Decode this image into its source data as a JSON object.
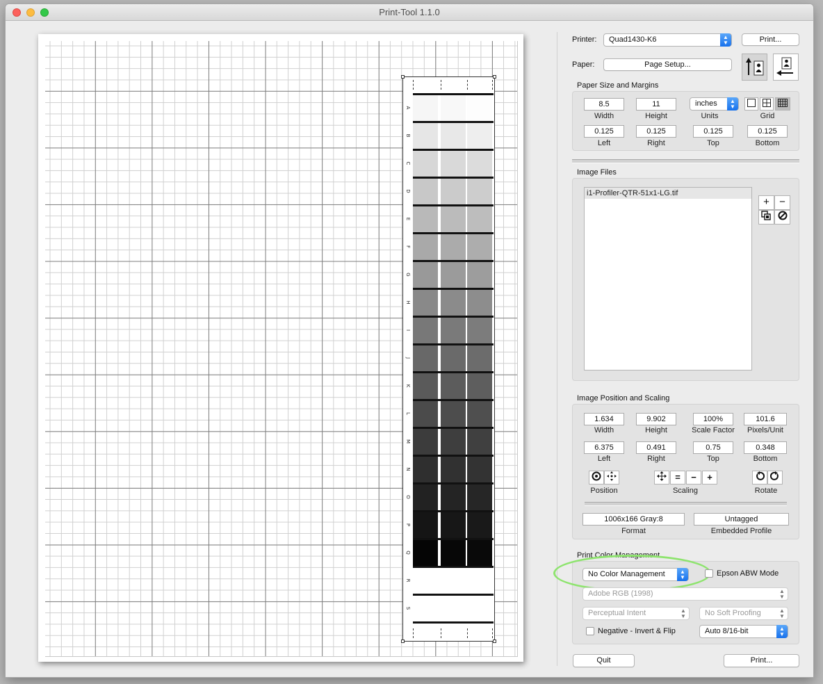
{
  "window": {
    "title": "Print-Tool 1.1.0"
  },
  "page_target": {
    "row_labels": [
      "A",
      "B",
      "C",
      "D",
      "E",
      "F",
      "G",
      "H",
      "I",
      "J",
      "K",
      "L",
      "M",
      "N",
      "O",
      "P",
      "Q",
      "R",
      "S"
    ],
    "row_grays": [
      [
        "#f6f6f6",
        "#f8f8f8",
        "#fdfdfd"
      ],
      [
        "#e6e6e6",
        "#e8e8e8",
        "#eeeeee"
      ],
      [
        "#d7d7d7",
        "#d9d9d9",
        "#dcdcdc"
      ],
      [
        "#c8c8c8",
        "#cbcbcb",
        "#cdcdcd"
      ],
      [
        "#b9b9b9",
        "#bbbbbb",
        "#bdbdbd"
      ],
      [
        "#a9a9a9",
        "#ababab",
        "#adadad"
      ],
      [
        "#999999",
        "#9b9b9b",
        "#9d9d9d"
      ],
      [
        "#898989",
        "#8b8b8b",
        "#8d8d8d"
      ],
      [
        "#787878",
        "#7a7a7a",
        "#7c7c7c"
      ],
      [
        "#686868",
        "#6a6a6a",
        "#6c6c6c"
      ],
      [
        "#5a5a5a",
        "#5c5c5c",
        "#5e5e5e"
      ],
      [
        "#4b4b4b",
        "#4d4d4d",
        "#4f4f4f"
      ],
      [
        "#3c3c3c",
        "#3e3e3e",
        "#404040"
      ],
      [
        "#2f2f2f",
        "#313131",
        "#333333"
      ],
      [
        "#222222",
        "#242424",
        "#262626"
      ],
      [
        "#151515",
        "#171717",
        "#191919"
      ],
      [
        "#050505",
        "#070707",
        "#090909"
      ]
    ]
  },
  "printer": {
    "label": "Printer:",
    "value": "Quad1430-K6",
    "print_button": "Print..."
  },
  "paper": {
    "label": "Paper:",
    "page_setup_button": "Page Setup..."
  },
  "orientation": {
    "portrait_icon": "portrait-icon",
    "landscape_icon": "landscape-icon"
  },
  "paper_size": {
    "title": "Paper Size and Margins",
    "width": {
      "value": "8.5",
      "label": "Width"
    },
    "height": {
      "value": "11",
      "label": "Height"
    },
    "units": {
      "value": "inches",
      "label": "Units"
    },
    "grid": {
      "label": "Grid"
    },
    "left": {
      "value": "0.125",
      "label": "Left"
    },
    "right": {
      "value": "0.125",
      "label": "Right"
    },
    "top": {
      "value": "0.125",
      "label": "Top"
    },
    "bottom": {
      "value": "0.125",
      "label": "Bottom"
    }
  },
  "image_files": {
    "title": "Image Files",
    "files": [
      "i1-Profiler-QTR-51x1-LG.tif"
    ],
    "add": "+",
    "remove": "−"
  },
  "image_position": {
    "title": "Image Position and Scaling",
    "width": {
      "value": "1.634",
      "label": "Width"
    },
    "height": {
      "value": "9.902",
      "label": "Height"
    },
    "scale": {
      "value": "100%",
      "label": "Scale Factor"
    },
    "ppu": {
      "value": "101.6",
      "label": "Pixels/Unit"
    },
    "left": {
      "value": "6.375",
      "label": "Left"
    },
    "right": {
      "value": "0.491",
      "label": "Right"
    },
    "top": {
      "value": "0.75",
      "label": "Top"
    },
    "bottom": {
      "value": "0.348",
      "label": "Bottom"
    },
    "position_label": "Position",
    "scaling_label": "Scaling",
    "rotate_label": "Rotate",
    "format": {
      "value": "1006x166 Gray:8",
      "label": "Format"
    },
    "profile": {
      "value": "Untagged",
      "label": "Embedded Profile"
    }
  },
  "color_mgmt": {
    "title": "Print Color Management",
    "mode": "No Color Management",
    "epson_abw": "Epson ABW Mode",
    "profile": "Adobe RGB (1998)",
    "intent": "Perceptual Intent",
    "proofing": "No Soft Proofing",
    "negative": "Negative - Invert & Flip",
    "bitdepth": "Auto 8/16-bit",
    "highlight_color": "#8ee46e"
  },
  "footer": {
    "quit": "Quit",
    "print": "Print..."
  }
}
